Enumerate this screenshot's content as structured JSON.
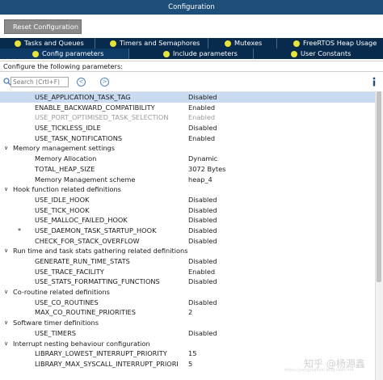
{
  "window": {
    "title": "Configuration"
  },
  "toolbar": {
    "reset_label": "Reset Configuration"
  },
  "tabs_row1": [
    {
      "label": "Tasks and Queues"
    },
    {
      "label": "Timers and Semaphores"
    },
    {
      "label": "Mutexes"
    },
    {
      "label": "FreeRTOS Heap Usage"
    }
  ],
  "tabs_row2": [
    {
      "label": "Config parameters",
      "active": true
    },
    {
      "label": "Include parameters"
    },
    {
      "label": "User Constants"
    }
  ],
  "hint": "Configure the following parameters:",
  "search": {
    "placeholder": "Search (Crtl+F)",
    "prev_icon": "<",
    "next_icon": ">"
  },
  "tree": [
    {
      "type": "param",
      "name": "USE_APPLICATION_TASK_TAG",
      "value": "Disabled",
      "selected": true
    },
    {
      "type": "param",
      "name": "ENABLE_BACKWARD_COMPATIBILITY",
      "value": "Enabled"
    },
    {
      "type": "param",
      "name": "USE_PORT_OPTIMISED_TASK_SELECTION",
      "value": "Enabled",
      "dim": true
    },
    {
      "type": "param",
      "name": "USE_TICKLESS_IDLE",
      "value": "Disabled"
    },
    {
      "type": "param",
      "name": "USE_TASK_NOTIFICATIONS",
      "value": "Enabled"
    },
    {
      "type": "group",
      "name": "Memory management settings"
    },
    {
      "type": "param",
      "name": "Memory Allocation",
      "value": "Dynamic"
    },
    {
      "type": "param",
      "name": "TOTAL_HEAP_SIZE",
      "value": "3072 Bytes"
    },
    {
      "type": "param",
      "name": "Memory Management scheme",
      "value": "heap_4"
    },
    {
      "type": "group",
      "name": "Hook function related definitions"
    },
    {
      "type": "param",
      "name": "USE_IDLE_HOOK",
      "value": "Disabled"
    },
    {
      "type": "param",
      "name": "USE_TICK_HOOK",
      "value": "Disabled"
    },
    {
      "type": "param",
      "name": "USE_MALLOC_FAILED_HOOK",
      "value": "Disabled"
    },
    {
      "type": "param",
      "name": "USE_DAEMON_TASK_STARTUP_HOOK",
      "value": "Disabled",
      "bullet": "*"
    },
    {
      "type": "param",
      "name": "CHECK_FOR_STACK_OVERFLOW",
      "value": "Disabled"
    },
    {
      "type": "group",
      "name": "Run time and task stats gathering related definitions"
    },
    {
      "type": "param",
      "name": "GENERATE_RUN_TIME_STATS",
      "value": "Disabled"
    },
    {
      "type": "param",
      "name": "USE_TRACE_FACILITY",
      "value": "Enabled"
    },
    {
      "type": "param",
      "name": "USE_STATS_FORMATTING_FUNCTIONS",
      "value": "Disabled"
    },
    {
      "type": "group",
      "name": "Co-routine related definitions"
    },
    {
      "type": "param",
      "name": "USE_CO_ROUTINES",
      "value": "Disabled"
    },
    {
      "type": "param",
      "name": "MAX_CO_ROUTINE_PRIORITIES",
      "value": "2"
    },
    {
      "type": "group",
      "name": "Software timer definitions"
    },
    {
      "type": "param",
      "name": "USE_TIMERS",
      "value": "Disabled"
    },
    {
      "type": "group",
      "name": "Interrupt nesting behaviour configuration"
    },
    {
      "type": "param",
      "name": "LIBRARY_LOWEST_INTERRUPT_PRIORITY",
      "value": "15"
    },
    {
      "type": "param",
      "name": "LIBRARY_MAX_SYSCALL_INTERRUPT_PRIORI",
      "value": "5"
    }
  ],
  "watermark": {
    "text": "知乎 @杨源鑫",
    "subtext": "https://yangyuanxin.blog.csdn.net"
  },
  "colors": {
    "titlebar": "#1e4f7a",
    "tab_bg": "#082b4d",
    "tab_dot": "#e7e33a",
    "selected_row": "#c8dbf0",
    "reset_button": "#8a8a8a"
  }
}
